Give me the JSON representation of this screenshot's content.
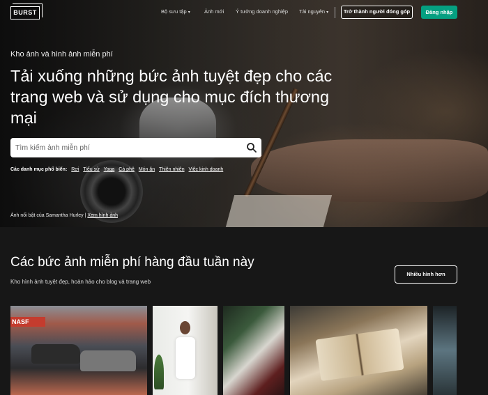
{
  "nav": {
    "logo": "BURST",
    "items": [
      {
        "label": "Bộ sưu tập",
        "has_chevron": true
      },
      {
        "label": "Ảnh mới",
        "has_chevron": false
      },
      {
        "label": "Ý tưởng doanh nghiệp",
        "has_chevron": false
      },
      {
        "label": "Tài nguyên",
        "has_chevron": true
      }
    ],
    "contribute_button": "Trở thành người đóng góp",
    "login_button": "Đăng nhập",
    "chevron_icon": "chevron-down-icon"
  },
  "hero": {
    "kicker": "Kho ảnh và hình ảnh miễn phí",
    "headline": "Tải xuống những bức ảnh tuyệt đẹp cho các trang web và sử dụng cho mục đích thương mại",
    "search": {
      "placeholder": "Tìm kiếm ảnh miễn phí",
      "value": "",
      "icon": "search-icon"
    },
    "popular_label": "Các danh mục phổ biến:",
    "popular": [
      "Rơi",
      "Tiểu sử",
      "Yoga",
      "Cà phê",
      "Món ăn",
      "Thiên nhiên",
      "Việc kinh doanh"
    ],
    "credit_prefix": "Ảnh nổi bật của Samantha Hurley |",
    "credit_link": "Xem hình ảnh"
  },
  "section": {
    "title": "Các bức ảnh miễn phí hàng đầu tuần này",
    "subtitle": "Kho hình ảnh tuyệt đẹp, hoàn hảo cho blog và trang web",
    "more_button": "Nhiều hình hơn",
    "photo_1_sign": "NASF"
  },
  "colors": {
    "accent": "#05a081",
    "background": "#171717"
  }
}
